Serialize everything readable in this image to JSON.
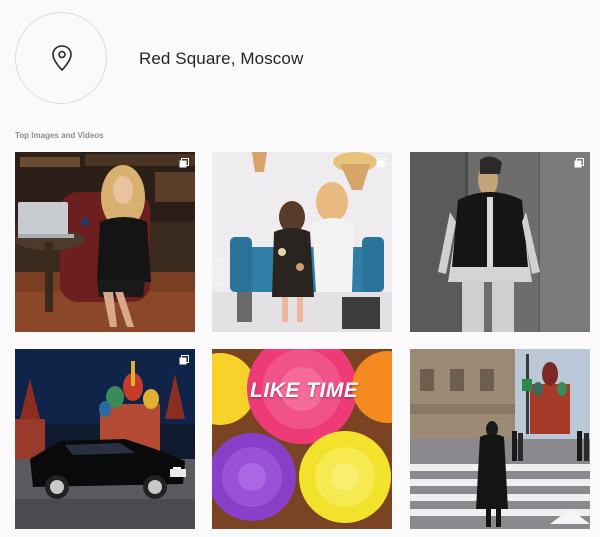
{
  "location": {
    "title": "Red Square, Moscow",
    "icon": "location-pin-icon"
  },
  "section": {
    "label": "Top Images and Videos"
  },
  "posts": [
    {
      "id": "woman-laptop",
      "multi": true
    },
    {
      "id": "mother-daughter",
      "multi": true
    },
    {
      "id": "puffer-vest",
      "multi": true
    },
    {
      "id": "car-red-square",
      "multi": true
    },
    {
      "id": "cupcakes",
      "caption": "LIKE TIME",
      "multi": false
    },
    {
      "id": "street-kremlin",
      "multi": false
    }
  ],
  "colors": {
    "background": "#fafafa",
    "text": "#262626",
    "muted": "#8e8e8e",
    "border": "#dbdbdb"
  }
}
